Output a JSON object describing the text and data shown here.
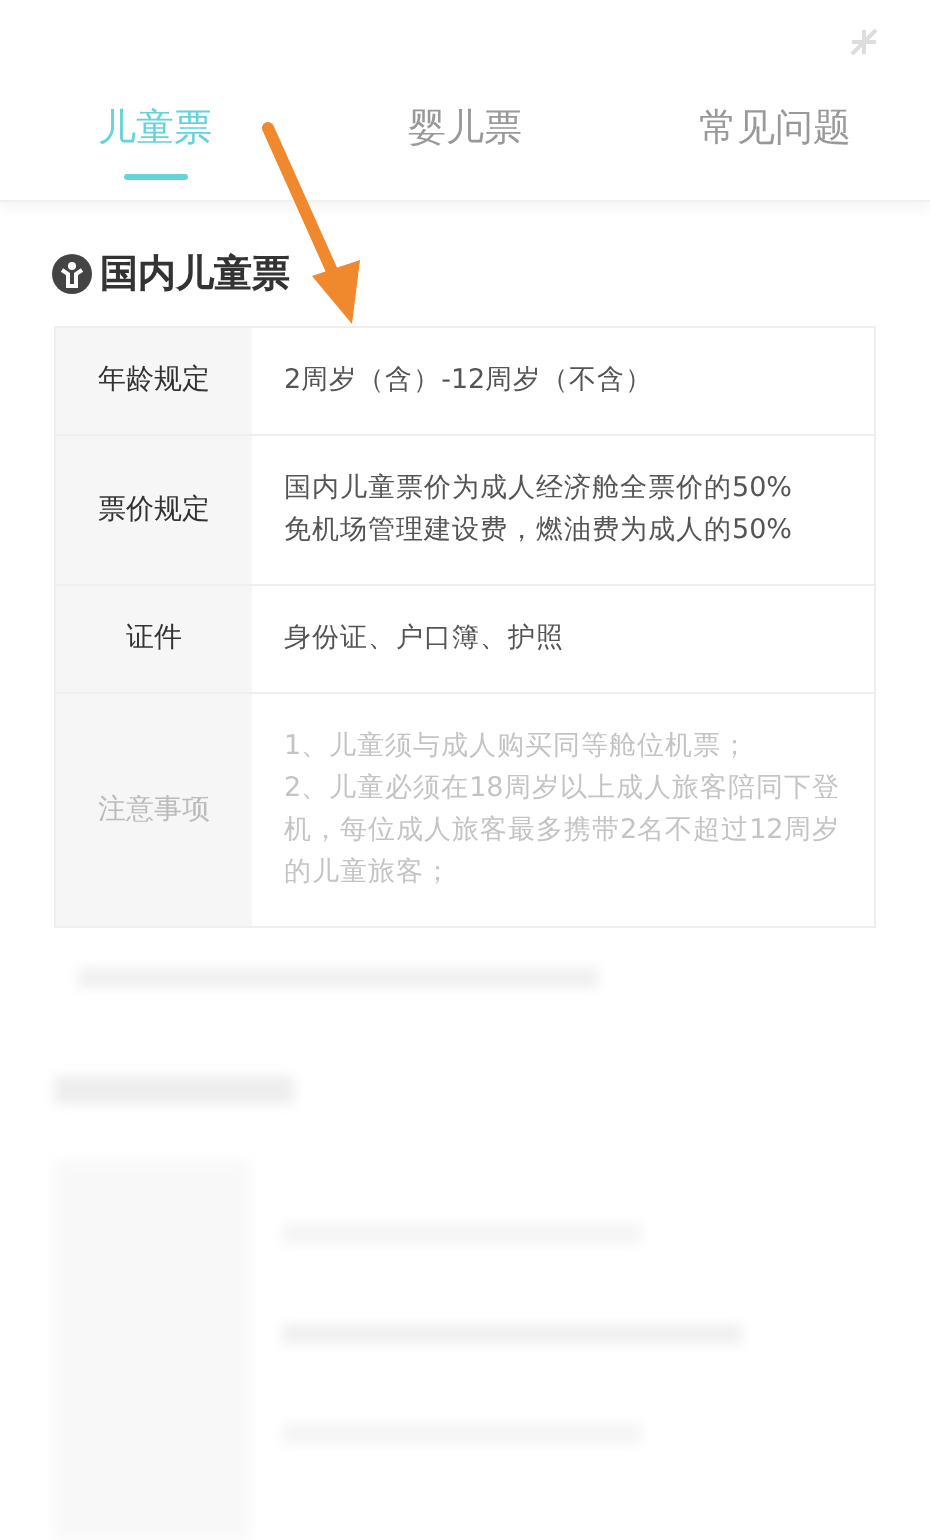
{
  "tabs": [
    {
      "label": "儿童票",
      "selected": true
    },
    {
      "label": "婴儿票",
      "selected": false
    },
    {
      "label": "常见问题",
      "selected": false
    }
  ],
  "section_title": "国内儿童票",
  "rules": [
    {
      "label": "年龄规定",
      "value": [
        "2周岁（含）-12周岁（不含）"
      ],
      "faded": false
    },
    {
      "label": "票价规定",
      "value": [
        "国内儿童票价为成人经济舱全票价的50%",
        "免机场管理建设费，燃油费为成人的50%"
      ],
      "faded": false
    },
    {
      "label": "证件",
      "value": [
        "身份证、户口簿、护照"
      ],
      "faded": false
    },
    {
      "label": "注意事项",
      "value": [
        "1、儿童须与成人购买同等舱位机票；",
        "2、儿童必须在18周岁以上成人旅客陪同下登机，每位成人旅客最多携带2名不超过12周岁的儿童旅客；"
      ],
      "faded": true
    }
  ]
}
